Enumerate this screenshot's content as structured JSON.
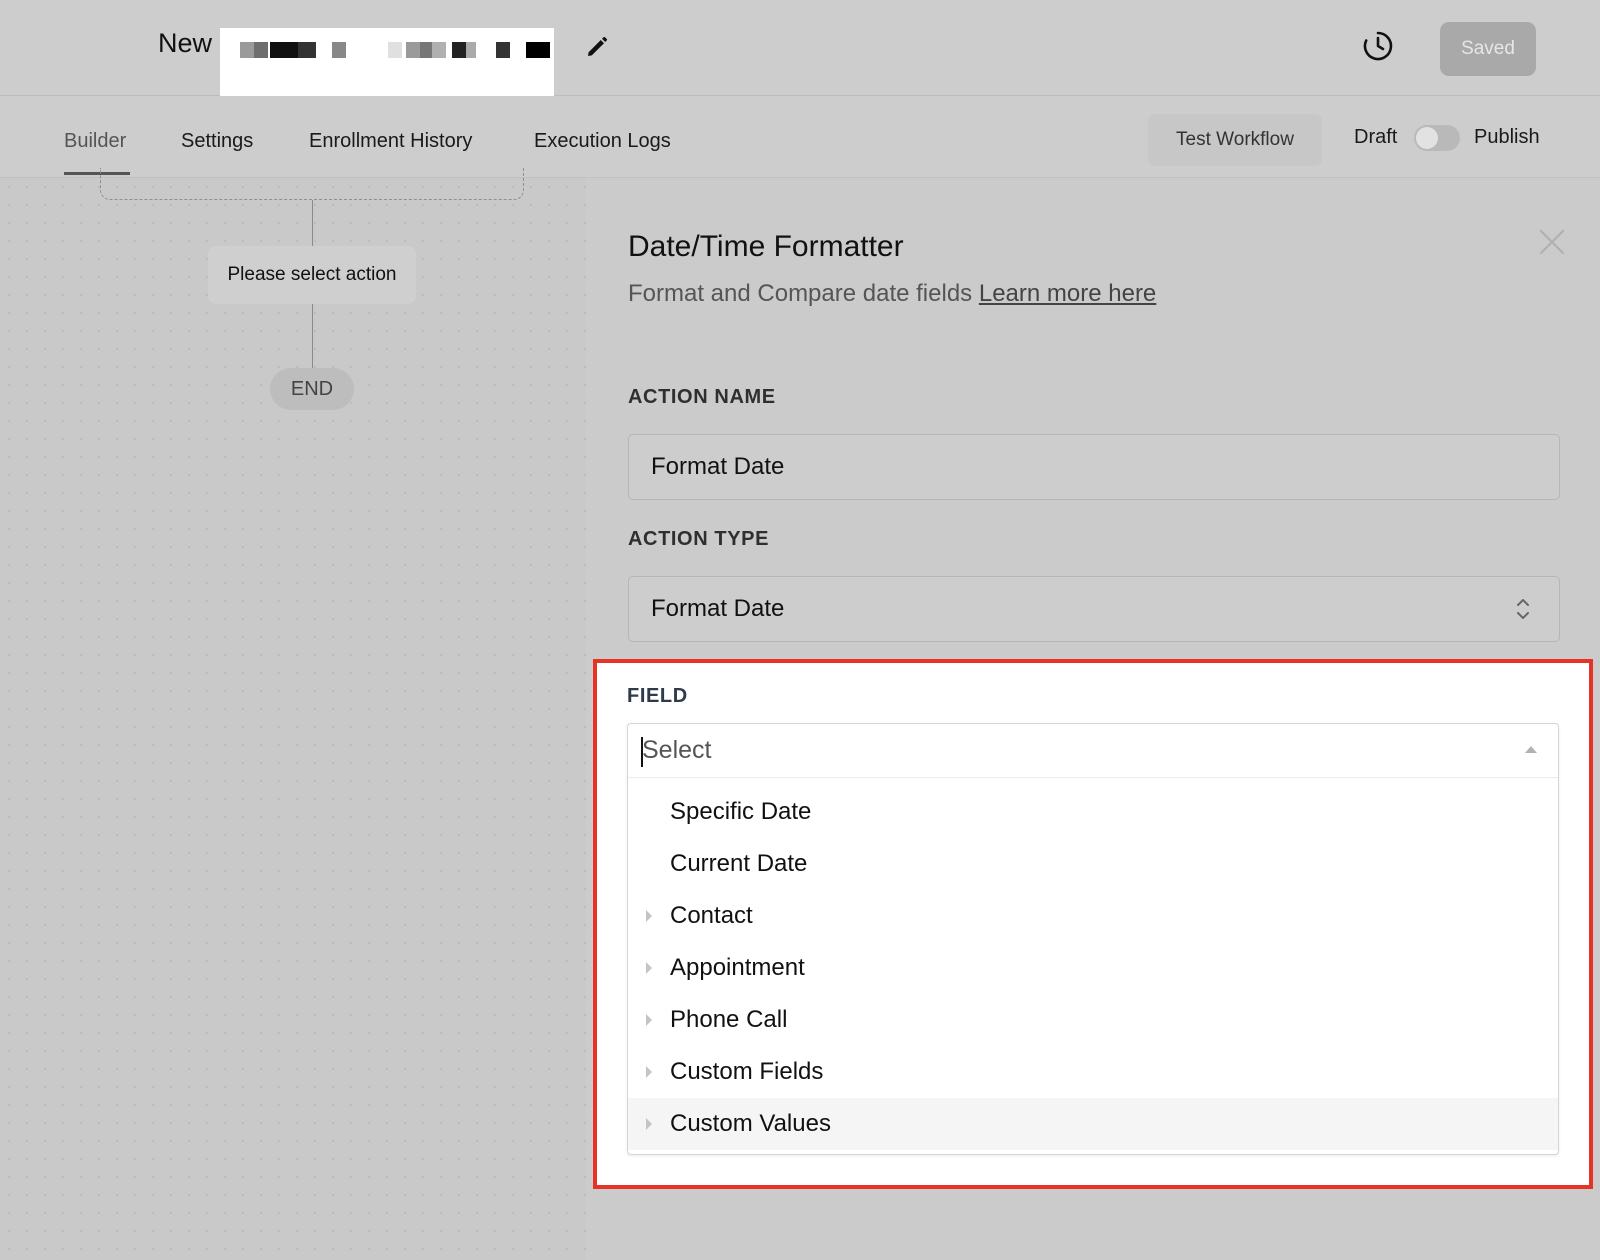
{
  "header": {
    "workflow_prefix": "New",
    "save_status": "Saved"
  },
  "tabs": [
    {
      "label": "Builder",
      "active": true
    },
    {
      "label": "Settings",
      "active": false
    },
    {
      "label": "Enrollment History",
      "active": false
    },
    {
      "label": "Execution Logs",
      "active": false
    }
  ],
  "toolbar": {
    "test_workflow": "Test Workflow",
    "draft_label": "Draft",
    "publish_label": "Publish",
    "published": false
  },
  "canvas": {
    "action_placeholder": "Please select action",
    "end_label": "END"
  },
  "panel": {
    "title": "Date/Time Formatter",
    "description": "Format and Compare date fields",
    "learn_more": "Learn more here",
    "action_name_label": "ACTION NAME",
    "action_name_value": "Format Date",
    "action_type_label": "ACTION TYPE",
    "action_type_value": "Format Date",
    "field_label": "FIELD",
    "field_placeholder": "Select",
    "field_options": [
      {
        "label": "Specific Date",
        "expandable": false
      },
      {
        "label": "Current Date",
        "expandable": false
      },
      {
        "label": "Contact",
        "expandable": true
      },
      {
        "label": "Appointment",
        "expandable": true
      },
      {
        "label": "Phone Call",
        "expandable": true
      },
      {
        "label": "Custom Fields",
        "expandable": true
      },
      {
        "label": "Custom Values",
        "expandable": true,
        "hovered": true
      }
    ]
  },
  "colors": {
    "highlight_border": "#e53326",
    "overlay_gray": "#cbcbcb"
  }
}
